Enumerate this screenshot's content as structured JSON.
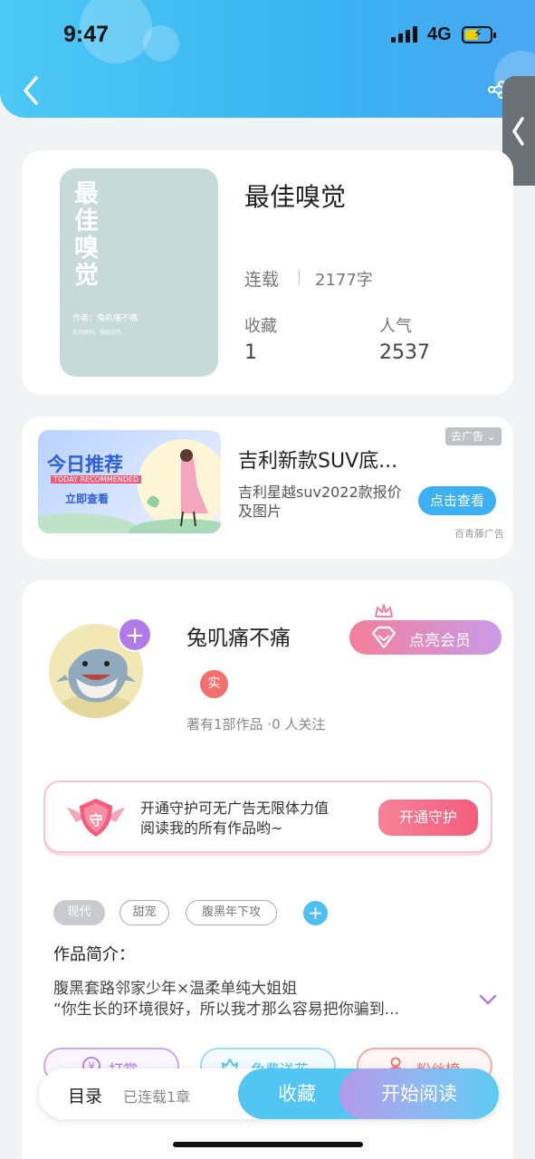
{
  "status_bar": {
    "time": "9:47",
    "network": "4G",
    "battery_level": 0.4
  },
  "header": {
    "back_icon": "chevron-left-icon",
    "share_icon": "share-icon",
    "side_tab_icon": "chevron-left-icon"
  },
  "book": {
    "cover_title": "最佳嗅觉",
    "cover_author": "作者：兔叽痛不痛",
    "cover_sub": "支持原创，侵权必究",
    "title": "最佳嗅觉",
    "status": "连载",
    "word_count": "2177字",
    "favorites_label": "收藏",
    "favorites_value": "1",
    "popularity_label": "人气",
    "popularity_value": "2537",
    "cover_color": "#c6dbd8"
  },
  "ad": {
    "image_title": "今日推荐",
    "image_subtitle": "TODAY RECOMMENDED",
    "image_button": "立即查看",
    "title": "吉利新款SUV底...",
    "description": "吉利星越suv2022款报价及图片",
    "close_label": "去广告",
    "cta_label": "点击查看",
    "source": "百青藤广告"
  },
  "author": {
    "name": "兔叽痛不痛",
    "vip_label": "点亮会员",
    "real_badge": "实",
    "meta": "著有1部作品 ·0 人关注"
  },
  "guard": {
    "icon_label": "守",
    "text_line1": "开通守护可无广告无限体力值",
    "text_line2": "阅读我的所有作品哟~",
    "button_label": "开通守护"
  },
  "tags": [
    "现代",
    "甜宠",
    "腹黑年下攻"
  ],
  "intro": {
    "label": "作品简介：",
    "line1": "腹黑套路邻家少年×温柔单纯大姐姐",
    "line2": "“你生长的环境很好，所以我才那么容易把你骗到..."
  },
  "actions": [
    {
      "label": "打赏",
      "icon": "yen-icon",
      "color": "#b07ae8"
    },
    {
      "label": "免费送花",
      "icon": "flower-icon",
      "color": "#4ec0f0"
    },
    {
      "label": "粉丝榜",
      "icon": "user-icon",
      "color": "#f1706e"
    }
  ],
  "bottom_bar": {
    "toc_label": "目录",
    "chapters_label": "已连载1章",
    "favorite_label": "收藏",
    "read_label": "开始阅读"
  },
  "colors": {
    "accent": "#3cb0f2",
    "vip": "#f47f9a",
    "guard": "#f45c7e"
  }
}
